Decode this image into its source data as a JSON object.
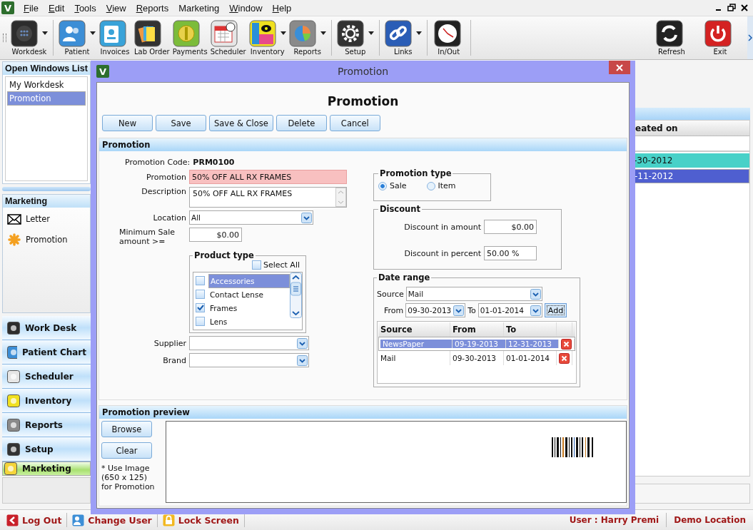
{
  "logo": "V",
  "menu": [
    {
      "label": "File",
      "underline": true
    },
    {
      "label": "Edit",
      "underline": true
    },
    {
      "label": "Tools",
      "underline": true
    },
    {
      "label": "View",
      "underline": true
    },
    {
      "label": "Reports",
      "underline": true
    },
    {
      "label": "Marketing",
      "underline": false
    },
    {
      "label": "Window",
      "underline": true
    },
    {
      "label": "Help",
      "underline": true
    }
  ],
  "toolbar": {
    "groups": [
      [
        {
          "label": "Workdesk",
          "kind": "workdesk",
          "dropdown": true
        }
      ],
      [
        {
          "label": "Patient",
          "kind": "patient",
          "dropdown": true
        },
        {
          "label": "Invoices",
          "kind": "invoices",
          "dropdown": false
        },
        {
          "label": "Lab Order",
          "kind": "laborder",
          "dropdown": false
        },
        {
          "label": "Payments",
          "kind": "payments",
          "dropdown": false
        },
        {
          "label": "Scheduler",
          "kind": "scheduler",
          "dropdown": false
        },
        {
          "label": "Inventory",
          "kind": "inventory",
          "dropdown": true
        },
        {
          "label": "Reports",
          "kind": "reports",
          "dropdown": true
        }
      ],
      [
        {
          "label": "Setup",
          "kind": "setup",
          "dropdown": true
        }
      ],
      [
        {
          "label": "Links",
          "kind": "links",
          "dropdown": true
        }
      ],
      [
        {
          "label": "In/Out",
          "kind": "inout",
          "dropdown": false
        }
      ]
    ],
    "right": [
      {
        "label": "Refresh",
        "kind": "refresh",
        "dropdown": false
      },
      {
        "label": "Exit",
        "kind": "exit",
        "dropdown": false
      }
    ]
  },
  "open_windows": {
    "title": "Open Windows List",
    "items": [
      {
        "label": "My Workdesk",
        "selected": false
      },
      {
        "label": "Promotion",
        "selected": true
      }
    ]
  },
  "marketing_panel": {
    "title": "Marketing",
    "items": [
      {
        "label": "Letter",
        "kind": "letter"
      },
      {
        "label": "Promotion",
        "kind": "promotion"
      }
    ]
  },
  "nav": [
    {
      "label": "Work Desk",
      "kind": "workdesk",
      "selected": false
    },
    {
      "label": "Patient Chart",
      "kind": "patient",
      "selected": false
    },
    {
      "label": "Scheduler",
      "kind": "scheduler",
      "selected": false
    },
    {
      "label": "Inventory",
      "kind": "inventory",
      "selected": false
    },
    {
      "label": "Reports",
      "kind": "reports",
      "selected": false
    },
    {
      "label": "Setup",
      "kind": "setup",
      "selected": false
    },
    {
      "label": "Marketing",
      "kind": "marketing",
      "selected": true
    }
  ],
  "background_list": {
    "column": "eated on",
    "rows": [
      {
        "text": "-30-2012",
        "color": "#48d1c8",
        "selected": false
      },
      {
        "text": "-11-2012",
        "color": "#4f5fd0",
        "selected": true
      }
    ]
  },
  "dialog": {
    "logo": "V",
    "title": "Promotion",
    "heading": "Promotion",
    "buttons": [
      "New",
      "Save",
      "Save & Close",
      "Delete",
      "Cancel"
    ],
    "section": "Promotion",
    "code_label": "Promotion Code:",
    "code": "PRM0100",
    "promotion": {
      "label": "Promotion",
      "value": "50% OFF ALL RX FRAMES",
      "invalid": true
    },
    "description": {
      "label": "Description",
      "value": "50% OFF ALL RX FRAMES"
    },
    "location": {
      "label": "Location",
      "value": "All"
    },
    "minimum_sale": {
      "label": "Minimum Sale amount >=",
      "value": "$0.00"
    },
    "product_type": {
      "title": "Product type",
      "select_all": {
        "label": "Select All",
        "checked": false
      },
      "items": [
        {
          "label": "Accessories",
          "checked": false,
          "selected": true
        },
        {
          "label": "Contact Lense",
          "checked": false,
          "selected": false
        },
        {
          "label": "Frames",
          "checked": true,
          "selected": false
        },
        {
          "label": "Lens",
          "checked": false,
          "selected": false
        }
      ]
    },
    "supplier": {
      "label": "Supplier"
    },
    "brand": {
      "label": "Brand"
    },
    "promotion_type": {
      "title": "Promotion type",
      "options": [
        {
          "label": "Sale",
          "selected": true
        },
        {
          "label": "Item",
          "selected": false
        }
      ]
    },
    "discount": {
      "title": "Discount",
      "amount": {
        "label": "Discount in amount",
        "value": "$0.00"
      },
      "percent": {
        "label": "Discount in percent",
        "value": "50.00 %"
      }
    },
    "date_range": {
      "title": "Date range",
      "source": {
        "label": "Source",
        "value": "Mail"
      },
      "from": {
        "label": "From",
        "value": "09-30-2013"
      },
      "to": {
        "label": "To",
        "value": "01-01-2014"
      },
      "add": "Add",
      "columns": [
        "Source",
        "From",
        "To"
      ],
      "rows": [
        {
          "source": "NewsPaper",
          "from": "09-19-2013",
          "to": "12-31-2013",
          "selected": true
        },
        {
          "source": "Mail",
          "from": "09-30-2013",
          "to": "01-01-2014",
          "selected": false
        }
      ]
    },
    "preview": {
      "title": "Promotion preview",
      "buttons": [
        "Browse",
        "Clear"
      ],
      "note": "* Use Image (650 x 125) for Promotion"
    }
  },
  "status_bar": {
    "actions": [
      {
        "label": "Log Out",
        "kind": "logout"
      },
      {
        "label": "Change User",
        "kind": "user"
      },
      {
        "label": "Lock Screen",
        "kind": "lock"
      }
    ],
    "user": "User : Harry Premi",
    "location": "Demo Location"
  }
}
